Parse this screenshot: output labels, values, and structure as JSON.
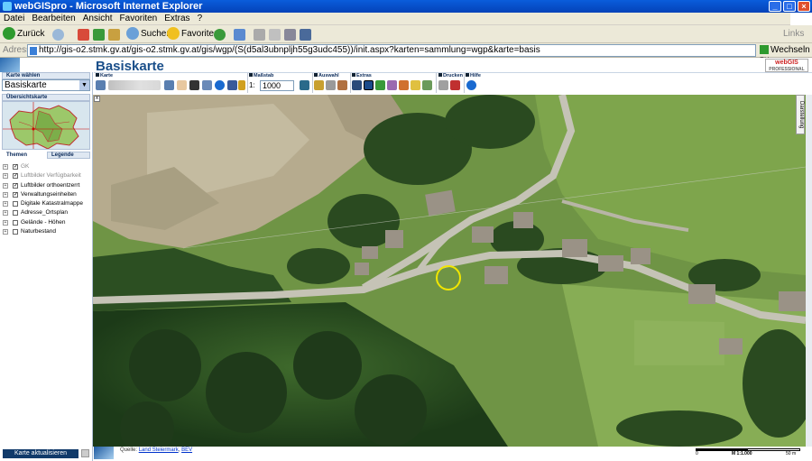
{
  "window": {
    "title": "webGISpro - Microsoft Internet Explorer",
    "minimize": "_",
    "maximize": "□",
    "close": "×"
  },
  "menu": [
    "Datei",
    "Bearbeiten",
    "Ansicht",
    "Favoriten",
    "Extras",
    "?"
  ],
  "toolbar": {
    "back_label": "Zurück",
    "search_label": "Suchen",
    "favorites_label": "Favoriten",
    "links_label": "Links"
  },
  "address": {
    "label": "Adresse",
    "url": "http://gis-o2.stmk.gv.at/gis-o2.stmk.gv.at/gis/wgp/(S(d5al3ubnpljh55g3udc455))/init.aspx?karten=sammlung=wgp&karte=basis",
    "go_label": "Wechseln zu"
  },
  "app": {
    "title": "Basiskarte",
    "brand_top": "webGIS",
    "brand_bottom": "PROFESSIONAL"
  },
  "left": {
    "map_select_head": "Karte wählen",
    "map_select_value": "Basiskarte",
    "overview_head": "Übersichtskarte",
    "themes_head": "Themen",
    "legend_head": "Legende",
    "themes": [
      {
        "label": "GK",
        "checked": true,
        "dim": true
      },
      {
        "label": "Luftbilder Verfügbarkeit",
        "checked": true,
        "dim": true
      },
      {
        "label": "Luftbilder orthoentzerrt",
        "checked": true,
        "dim": false
      },
      {
        "label": "Verwaltungseinheiten",
        "checked": true,
        "dim": false
      },
      {
        "label": "Digitale Katastralmappe",
        "checked": false,
        "dim": false
      },
      {
        "label": "Adresse_Ortsplan",
        "checked": false,
        "dim": false
      },
      {
        "label": "Gelände - Höhen",
        "checked": false,
        "dim": false
      },
      {
        "label": "Naturbestand",
        "checked": false,
        "dim": false
      }
    ],
    "refresh_label": "Karte aktualisieren"
  },
  "tools": {
    "karte": "Karte",
    "massstab": "Maßstab",
    "scale_prefix": "1:",
    "scale_value": "1000",
    "auswahl": "Auswahl",
    "extras": "Extras",
    "drucken": "Drucken",
    "hilfe": "Hilfe"
  },
  "map": {
    "side_tab": "Darstellung",
    "corner_label": "x"
  },
  "footer": {
    "source_prefix": "Quelle: ",
    "source_link1": "Land Steiermark",
    "source_sep": ", ",
    "source_link2": "BEV",
    "scale_left": "0",
    "scale_mid": "M 1:1.000",
    "scale_right": "50 m"
  },
  "colors": {
    "title_blue": "#0a5ddb",
    "app_title": "#1a4f8a",
    "refresh_bg": "#113a6a",
    "marker": "#f2e600"
  }
}
